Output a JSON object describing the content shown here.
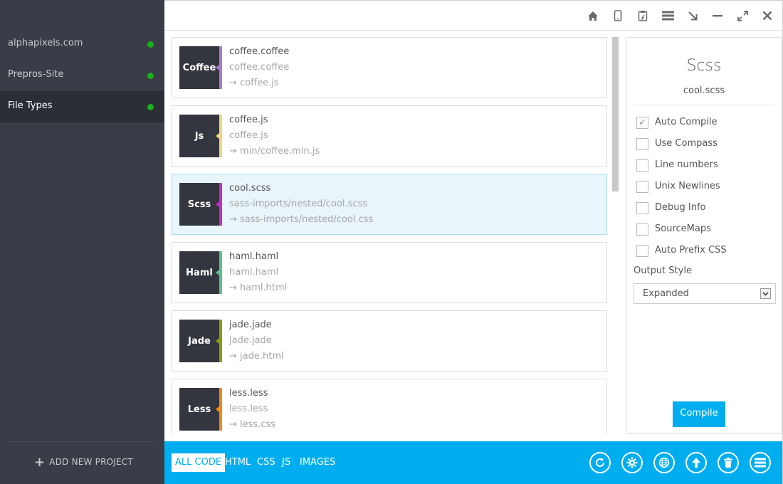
{
  "sidebar": {
    "projects": [
      {
        "name": "alphapixels.com",
        "status_color": "#19b01e"
      },
      {
        "name": "Prepros-Site",
        "status_color": "#19b01e"
      },
      {
        "name": "File Types",
        "status_color": "#19b01e",
        "active": true
      }
    ],
    "add_project_label": "ADD NEW PROJECT"
  },
  "titlebar": {
    "icons": [
      "home-icon",
      "mobile-icon",
      "clipboard-icon",
      "menu-icon",
      "arrow-down-right-icon",
      "minimize-icon",
      "fullscreen-icon",
      "close-icon"
    ]
  },
  "files": [
    {
      "type": "Coffee",
      "name": "coffee.coffee",
      "input": "coffee.coffee",
      "output": "→ coffee.js",
      "accent": "#a77bc8"
    },
    {
      "type": "Js",
      "name": "coffee.js",
      "input": "coffee.js",
      "output": "→ min/coffee.min.js",
      "accent": "#efd780"
    },
    {
      "type": "Scss",
      "name": "cool.scss",
      "input": "sass-imports/nested/cool.scss",
      "output": "→ sass-imports/nested/cool.css",
      "accent": "#c02ec6",
      "selected": true
    },
    {
      "type": "Haml",
      "name": "haml.haml",
      "input": "haml.haml",
      "output": "→ haml.html",
      "accent": "#5cc08b"
    },
    {
      "type": "Jade",
      "name": "jade.jade",
      "input": "jade.jade",
      "output": "→ jade.html",
      "accent": "#8a9e12"
    },
    {
      "type": "Less",
      "name": "less.less",
      "input": "less.less",
      "output": "→ less.css",
      "accent": "#f08a12"
    }
  ],
  "options": {
    "title": "Scss",
    "filename": "cool.scss",
    "checkboxes": [
      {
        "label": "Auto Compile",
        "checked": true
      },
      {
        "label": "Use Compass",
        "checked": false
      },
      {
        "label": "Line numbers",
        "checked": false
      },
      {
        "label": "Unix Newlines",
        "checked": false
      },
      {
        "label": "Debug Info",
        "checked": false
      },
      {
        "label": "SourceMaps",
        "checked": false
      },
      {
        "label": "Auto Prefix CSS",
        "checked": false
      }
    ],
    "output_style_label": "Output Style",
    "output_style_value": "Expanded",
    "compile_label": "Compile"
  },
  "bottombar": {
    "filters": [
      "ALL CODE",
      "HTML",
      "CSS",
      "JS",
      "IMAGES"
    ],
    "active_filter": "ALL CODE",
    "actions": [
      "refresh-icon",
      "settings-icon",
      "globe-icon",
      "upload-icon",
      "trash-icon",
      "list-icon"
    ]
  }
}
